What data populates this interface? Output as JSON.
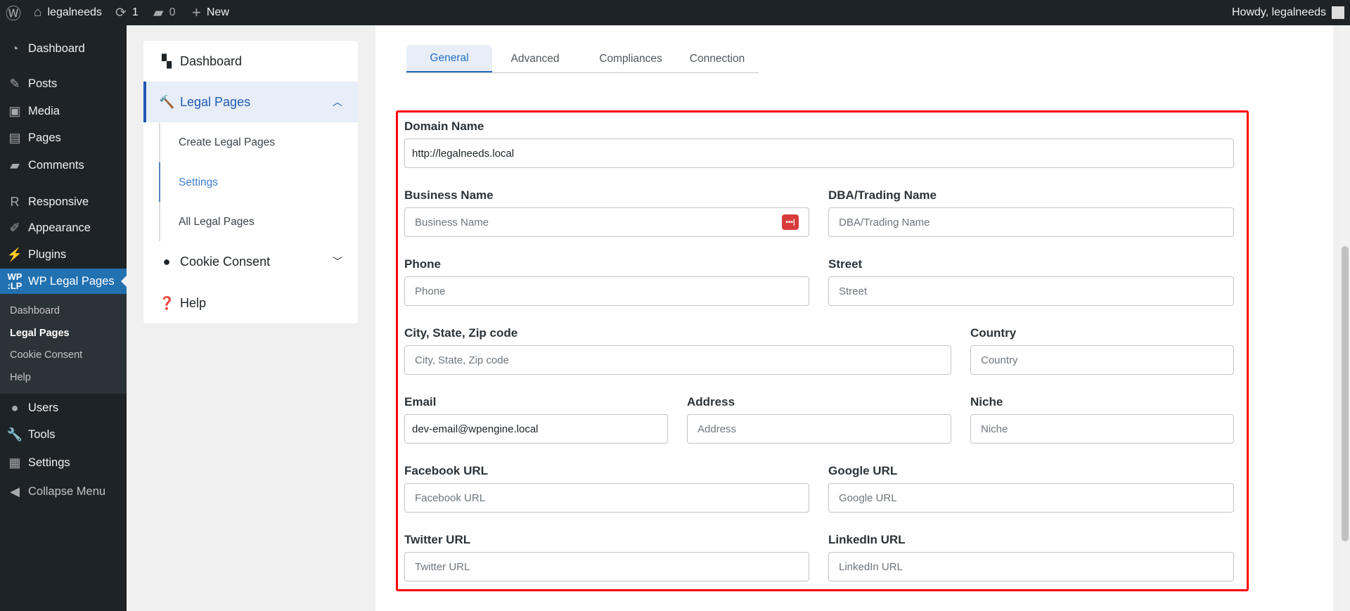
{
  "topbar": {
    "site": "legalneeds",
    "updates": "1",
    "comments": "0",
    "new": "New",
    "howdy": "Howdy, legalneeds"
  },
  "sidebar": {
    "items": [
      {
        "label": "Dashboard",
        "icon": "dashboard-icon"
      },
      {
        "label": "Posts",
        "icon": "pin-icon"
      },
      {
        "label": "Media",
        "icon": "media-icon"
      },
      {
        "label": "Pages",
        "icon": "pages-icon"
      },
      {
        "label": "Comments",
        "icon": "comment-icon"
      },
      {
        "label": "Responsive",
        "icon": "responsive-icon"
      },
      {
        "label": "Appearance",
        "icon": "brush-icon"
      },
      {
        "label": "Plugins",
        "icon": "plugin-icon"
      },
      {
        "label": "WP Legal Pages",
        "icon": "wplp-icon"
      },
      {
        "label": "Users",
        "icon": "user-icon"
      },
      {
        "label": "Tools",
        "icon": "wrench-icon"
      },
      {
        "label": "Settings",
        "icon": "settings-icon"
      },
      {
        "label": "Collapse Menu",
        "icon": "collapse-icon"
      }
    ],
    "submenu": [
      "Dashboard",
      "Legal Pages",
      "Cookie Consent",
      "Help"
    ],
    "wplp_logo": "WP LP"
  },
  "plugin_nav": {
    "dashboard": "Dashboard",
    "legal_pages": "Legal Pages",
    "sub": [
      "Create Legal Pages",
      "Settings",
      "All Legal Pages"
    ],
    "cookie": "Cookie Consent",
    "help": "Help"
  },
  "tabs": [
    "General",
    "Advanced",
    "Compliances",
    "Connection"
  ],
  "form": {
    "domain": {
      "label": "Domain Name",
      "value": "http://legalneeds.local"
    },
    "business": {
      "label": "Business Name",
      "placeholder": "Business Name"
    },
    "dba": {
      "label": "DBA/Trading Name",
      "placeholder": "DBA/Trading Name"
    },
    "phone": {
      "label": "Phone",
      "placeholder": "Phone"
    },
    "street": {
      "label": "Street",
      "placeholder": "Street"
    },
    "city": {
      "label": "City, State, Zip code",
      "placeholder": "City, State, Zip code"
    },
    "country": {
      "label": "Country",
      "placeholder": "Country"
    },
    "email": {
      "label": "Email",
      "value": "dev-email@wpengine.local"
    },
    "address": {
      "label": "Address",
      "placeholder": "Address"
    },
    "niche": {
      "label": "Niche",
      "placeholder": "Niche"
    },
    "facebook": {
      "label": "Facebook URL",
      "placeholder": "Facebook URL"
    },
    "google": {
      "label": "Google URL",
      "placeholder": "Google URL"
    },
    "twitter": {
      "label": "Twitter URL",
      "placeholder": "Twitter URL"
    },
    "linkedin": {
      "label": "LinkedIn URL",
      "placeholder": "LinkedIn URL"
    }
  },
  "colors": {
    "accent": "#2271b1",
    "highlight": "#ff0000",
    "admin_bg": "#1d2327"
  }
}
